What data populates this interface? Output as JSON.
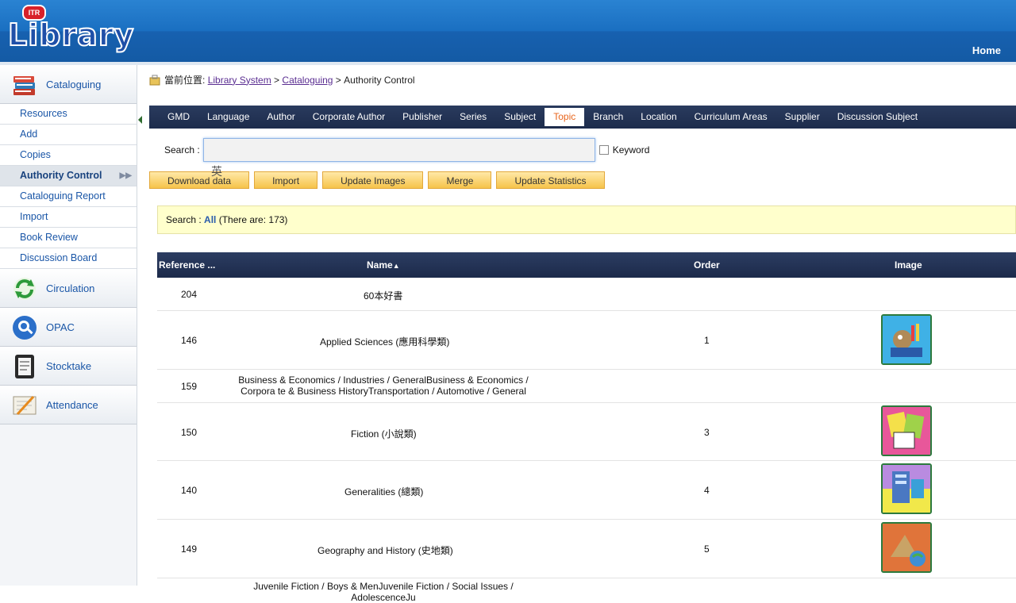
{
  "header": {
    "logo_badge": "ITR",
    "logo_text": "Library",
    "home_label": "Home"
  },
  "sidebar": {
    "sections": [
      {
        "label": "Cataloguing",
        "icon": "books-icon"
      },
      {
        "label": "Circulation",
        "icon": "refresh-icon"
      },
      {
        "label": "OPAC",
        "icon": "magnifier-icon"
      },
      {
        "label": "Stocktake",
        "icon": "clipboard-icon"
      },
      {
        "label": "Attendance",
        "icon": "pen-paper-icon"
      }
    ],
    "cataloguing_items": [
      {
        "label": "Resources"
      },
      {
        "label": "Add"
      },
      {
        "label": "Copies"
      },
      {
        "label": "Authority Control",
        "active": true
      },
      {
        "label": "Cataloguing Report"
      },
      {
        "label": "Import"
      },
      {
        "label": "Book Review"
      },
      {
        "label": "Discussion Board"
      }
    ]
  },
  "breadcrumb": {
    "prefix": "當前位置:",
    "link1": "Library System",
    "sep1": " > ",
    "link2": "Cataloguing",
    "sep2": " > ",
    "current": "Authority Control"
  },
  "tabs": [
    {
      "label": "GMD"
    },
    {
      "label": "Language"
    },
    {
      "label": "Author"
    },
    {
      "label": "Corporate Author"
    },
    {
      "label": "Publisher"
    },
    {
      "label": "Series"
    },
    {
      "label": "Subject"
    },
    {
      "label": "Topic",
      "active": true
    },
    {
      "label": "Branch"
    },
    {
      "label": "Location"
    },
    {
      "label": "Curriculum Areas"
    },
    {
      "label": "Supplier"
    },
    {
      "label": "Discussion Subject"
    }
  ],
  "search": {
    "label": "Search :",
    "value": "",
    "keyword_label": "Keyword",
    "ime_hint": "英"
  },
  "buttons": {
    "download": "Download data",
    "import": "Import",
    "update_images": "Update Images",
    "merge": "Merge",
    "update_statistics": "Update Statistics"
  },
  "info": {
    "prefix": "Search : ",
    "all": "All",
    "count_text": " (There are: 173)"
  },
  "table": {
    "headers": {
      "reference": "Reference ...",
      "name": "Name",
      "name_sort": "▲",
      "order": "Order",
      "image": "Image"
    },
    "rows": [
      {
        "ref": "204",
        "name": "60本好書",
        "order": "",
        "image": ""
      },
      {
        "ref": "146",
        "name": "Applied Sciences (應用科學類)",
        "order": "1",
        "image": "science-thumb"
      },
      {
        "ref": "159",
        "name": "Business & Economics / Industries / GeneralBusiness & Economics / Corpora te & Business HistoryTransportation / Automotive / General",
        "order": "",
        "image": ""
      },
      {
        "ref": "150",
        "name": "Fiction (小說類)",
        "order": "3",
        "image": "fiction-thumb"
      },
      {
        "ref": "140",
        "name": "Generalities (總類)",
        "order": "4",
        "image": "generalities-thumb"
      },
      {
        "ref": "149",
        "name": "Geography and History (史地類)",
        "order": "5",
        "image": "geography-thumb"
      },
      {
        "ref": "",
        "name": "Juvenile Fiction / Boys & MenJuvenile Fiction / Social Issues / AdolescenceJu",
        "order": "",
        "image": ""
      }
    ]
  }
}
